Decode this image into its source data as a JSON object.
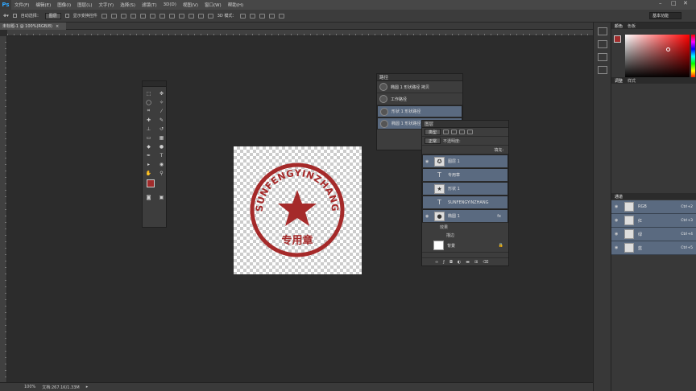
{
  "menubar": {
    "logo": "Ps",
    "items": [
      "文件(F)",
      "编辑(E)",
      "图像(I)",
      "图层(L)",
      "文字(Y)",
      "选择(S)",
      "滤镜(T)",
      "3D(D)",
      "视图(V)",
      "窗口(W)",
      "帮助(H)"
    ]
  },
  "options": {
    "auto_select": "自动选择：",
    "target": "图层",
    "transform": "显示变换控件",
    "mode3d": "3D 模式：",
    "workspace": "基本功能"
  },
  "doc": {
    "tab": "未标题-1 @ 100%(RGB/8)"
  },
  "status": {
    "zoom": "100%",
    "doc_size": "文档:267.1K/1.33M"
  },
  "stamp": {
    "arc_text": "SUNFENGYINZHANG",
    "label": "专用章",
    "color": "#a52a2a"
  },
  "paths_panel": {
    "title": "路径",
    "rows": [
      {
        "label": "椭圆 1 形状路径 拷贝",
        "selected": false
      },
      {
        "label": "工作路径",
        "selected": false
      },
      {
        "label": "形状 1 形状路径",
        "selected": true
      },
      {
        "label": "椭圆 1 形状路径",
        "selected": true
      }
    ]
  },
  "layers_panel": {
    "title": "图层",
    "kind": "类型",
    "blend": "正常",
    "opacity_label": "不透明度:",
    "fill_label": "填充:",
    "layers": [
      {
        "name": "图层 1",
        "type": "img",
        "selected": true
      },
      {
        "name": "专用章",
        "type": "text",
        "selected": true
      },
      {
        "name": "形状 1",
        "type": "img",
        "selected": true
      },
      {
        "name": "SUNFENGYINZHANG",
        "type": "text",
        "selected": true
      },
      {
        "name": "椭圆 1",
        "type": "img",
        "selected": true
      }
    ],
    "effects": "效果",
    "stroke": "描边",
    "background": "背景"
  },
  "color_panel": {
    "tabs": [
      "颜色",
      "色板"
    ]
  },
  "adjust_panel": {
    "tabs": [
      "调整",
      "样式"
    ]
  },
  "channels_panel": {
    "title": "通道",
    "channels": [
      {
        "name": "RGB",
        "key": "Ctrl+2"
      },
      {
        "name": "红",
        "key": "Ctrl+3"
      },
      {
        "name": "绿",
        "key": "Ctrl+4"
      },
      {
        "name": "蓝",
        "key": "Ctrl+5"
      }
    ]
  },
  "colors": {
    "foreground": "#a02c2c",
    "background": "#000000"
  }
}
